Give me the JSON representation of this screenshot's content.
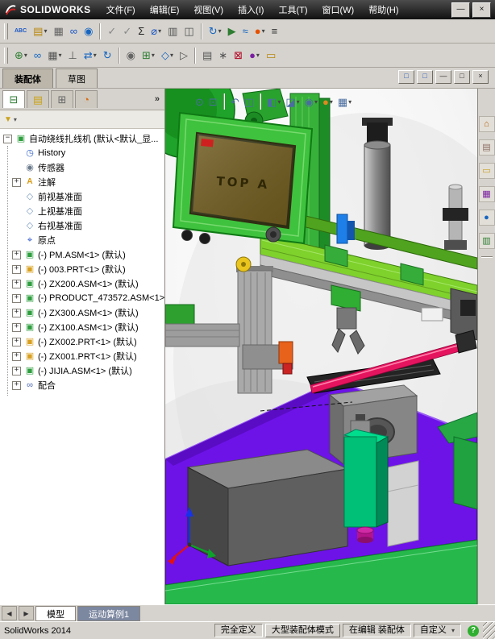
{
  "window": {
    "logo_text": "SOLIDWORKS"
  },
  "ui": {
    "minimize": "—",
    "close": "×",
    "caret": "▾",
    "chevron": "»",
    "funnel": "▼",
    "scroll_left": "◀",
    "scroll_right": "▶"
  },
  "menu": [
    {
      "name": "menu-file",
      "label": "文件(F)"
    },
    {
      "name": "menu-edit",
      "label": "编辑(E)"
    },
    {
      "name": "menu-view",
      "label": "视图(V)"
    },
    {
      "name": "menu-insert",
      "label": "插入(I)"
    },
    {
      "name": "menu-tools",
      "label": "工具(T)"
    },
    {
      "name": "menu-window",
      "label": "窗口(W)"
    },
    {
      "name": "menu-help",
      "label": "帮助(H)"
    }
  ],
  "toolbar_row1": [
    {
      "name": "spellcheck-icon",
      "glyph": "ABC",
      "color": "#1a56c4"
    },
    {
      "name": "design-binder-icon",
      "glyph": "▤",
      "color": "#b8860b",
      "caret": true
    },
    {
      "name": "design-table-icon",
      "glyph": "▦",
      "color": "#666666"
    },
    {
      "name": "hyperlink-icon",
      "glyph": "∞",
      "color": "#1a56c4"
    },
    {
      "name": "web-options-icon",
      "glyph": "◉",
      "color": "#1565c0"
    },
    {
      "sep": true
    },
    {
      "name": "select-filter-icon",
      "glyph": "✓",
      "color": "#888888"
    },
    {
      "name": "verification-icon",
      "glyph": "✓",
      "color": "#888888"
    },
    {
      "name": "equations-icon",
      "glyph": "Σ",
      "color": "#222222"
    },
    {
      "name": "measure-icon",
      "glyph": "⌀",
      "color": "#1a56c4",
      "caret": true
    },
    {
      "name": "mass-properties-icon",
      "glyph": "▥",
      "color": "#555555"
    },
    {
      "name": "section-properties-icon",
      "glyph": "◫",
      "color": "#555555"
    },
    {
      "sep": true
    },
    {
      "name": "motion-manager-icon",
      "glyph": "↻",
      "color": "#1565c0",
      "caret": true
    },
    {
      "name": "simulation-icon",
      "glyph": "▶",
      "color": "#2e7d32"
    },
    {
      "name": "flow-icon",
      "glyph": "≈",
      "color": "#1565c0"
    },
    {
      "name": "render-icon",
      "glyph": "●",
      "color": "#e65100",
      "caret": true
    },
    {
      "name": "options-icon",
      "glyph": "≡",
      "color": "#333333"
    }
  ],
  "toolbar_row2": [
    {
      "name": "insert-component-icon",
      "glyph": "⊕",
      "color": "#2e7d32",
      "caret": true
    },
    {
      "name": "mate-icon",
      "glyph": "∞",
      "color": "#1565c0"
    },
    {
      "name": "linear-pattern-icon",
      "glyph": "▦",
      "color": "#555555",
      "caret": true
    },
    {
      "name": "smart-fastener-icon",
      "glyph": "⊥",
      "color": "#555555"
    },
    {
      "name": "move-component-icon",
      "glyph": "⇄",
      "color": "#1565c0",
      "caret": true
    },
    {
      "name": "rotate-component-icon",
      "glyph": "↻",
      "color": "#1565c0"
    },
    {
      "sep": true
    },
    {
      "name": "show-hidden-icon",
      "glyph": "◉",
      "color": "#666666"
    },
    {
      "name": "assembly-features-icon",
      "glyph": "⊞",
      "color": "#2e7d32",
      "caret": true
    },
    {
      "name": "reference-geometry-icon",
      "glyph": "◇",
      "color": "#1565c0",
      "caret": true
    },
    {
      "name": "new-motion-study-icon",
      "glyph": "▷",
      "color": "#555555"
    },
    {
      "sep": true
    },
    {
      "name": "bom-icon",
      "glyph": "▤",
      "color": "#555555"
    },
    {
      "name": "exploded-view-icon",
      "glyph": "∗",
      "color": "#555555"
    },
    {
      "name": "interference-detection-icon",
      "glyph": "⊠",
      "color": "#b00020"
    },
    {
      "name": "appearances-toolbar-icon",
      "glyph": "●",
      "color": "#7b1fa2",
      "caret": true
    },
    {
      "name": "pack-and-go-icon",
      "glyph": "▭",
      "color": "#b8860b"
    }
  ],
  "panel_tabs": {
    "assembly": "装配体",
    "sketch": "草图"
  },
  "doc_controls": {
    "prev": "□",
    "next": "□",
    "minimize": "—",
    "restore": "□",
    "close": "×"
  },
  "manager_tabs": [
    {
      "name": "feature-manager-tab",
      "glyph": "⊟",
      "color": "#2e7d32",
      "active": true
    },
    {
      "name": "property-manager-tab",
      "glyph": "▤",
      "color": "#caa21a"
    },
    {
      "name": "configuration-manager-tab",
      "glyph": "⊞",
      "color": "#666666"
    },
    {
      "name": "display-manager-tab",
      "glyph": "◔",
      "color": "#d86a10"
    }
  ],
  "tree": {
    "root_label": "自动绕线扎线机",
    "root_suffix": "(默认<默认_显...",
    "root_glyph": "▣",
    "collapse_glyph": "−",
    "expand_glyph": "+",
    "items": [
      {
        "name": "tree-item-history",
        "icon": "history-icon",
        "glyph": "◷",
        "cls": "ic-blue",
        "label": "History"
      },
      {
        "name": "tree-item-sensors",
        "icon": "sensors-icon",
        "glyph": "◉",
        "cls": "ic-gray",
        "label": "传感器"
      },
      {
        "name": "tree-item-annotations",
        "icon": "annotations-icon",
        "glyph": "A",
        "cls": "ic-note",
        "label": "注解",
        "exp": true
      },
      {
        "name": "tree-item-front-plane",
        "icon": "plane-icon",
        "glyph": "◇",
        "cls": "ic-plane",
        "label": "前视基准面"
      },
      {
        "name": "tree-item-top-plane",
        "icon": "plane-icon",
        "glyph": "◇",
        "cls": "ic-plane",
        "label": "上视基准面"
      },
      {
        "name": "tree-item-right-plane",
        "icon": "plane-icon",
        "glyph": "◇",
        "cls": "ic-plane",
        "label": "右视基准面"
      },
      {
        "name": "tree-item-origin",
        "icon": "origin-icon",
        "glyph": "⌖",
        "cls": "ic-origin",
        "label": "原点"
      },
      {
        "name": "tree-item-pm-asm",
        "icon": "assembly-icon",
        "glyph": "▣",
        "cls": "ic-asm",
        "label": "(-) PM.ASM<1> (默认)",
        "exp": true
      },
      {
        "name": "tree-item-003-prt",
        "icon": "part-icon",
        "glyph": "▣",
        "cls": "ic-prt",
        "label": "(-) 003.PRT<1> (默认)",
        "exp": true
      },
      {
        "name": "tree-item-zx200-asm",
        "icon": "assembly-icon",
        "glyph": "▣",
        "cls": "ic-asm",
        "label": "(-) ZX200.ASM<1> (默认)",
        "exp": true
      },
      {
        "name": "tree-item-product-473572-asm",
        "icon": "assembly-icon",
        "glyph": "▣",
        "cls": "ic-asm",
        "label": "(-) PRODUCT_473572.ASM<1>",
        "exp": true
      },
      {
        "name": "tree-item-zx300-asm",
        "icon": "assembly-icon",
        "glyph": "▣",
        "cls": "ic-asm",
        "label": "(-) ZX300.ASM<1> (默认)",
        "exp": true
      },
      {
        "name": "tree-item-zx100-asm",
        "icon": "assembly-icon",
        "glyph": "▣",
        "cls": "ic-asm",
        "label": "(-) ZX100.ASM<1> (默认)",
        "exp": true
      },
      {
        "name": "tree-item-zx002-prt",
        "icon": "part-icon",
        "glyph": "▣",
        "cls": "ic-prt",
        "label": "(-) ZX002.PRT<1> (默认)",
        "exp": true
      },
      {
        "name": "tree-item-zx001-prt",
        "icon": "part-icon",
        "glyph": "▣",
        "cls": "ic-prt",
        "label": "(-) ZX001.PRT<1> (默认)",
        "exp": true
      },
      {
        "name": "tree-item-jijia-asm",
        "icon": "assembly-icon",
        "glyph": "▣",
        "cls": "ic-asm",
        "label": "(-) JIJIA.ASM<1> (默认)",
        "exp": true
      },
      {
        "name": "tree-item-mates",
        "icon": "mates-icon",
        "glyph": "∞",
        "cls": "ic-mate",
        "label": "配合",
        "exp": true
      }
    ]
  },
  "headsup": [
    {
      "name": "zoom-fit-icon",
      "glyph": "⊙"
    },
    {
      "name": "zoom-area-icon",
      "glyph": "⊡"
    },
    {
      "sep": true
    },
    {
      "name": "previous-view-icon",
      "glyph": "↶"
    },
    {
      "name": "section-view-icon",
      "glyph": "◫"
    },
    {
      "sep": true
    },
    {
      "name": "view-orientation-icon",
      "glyph": "◧",
      "caret": true
    },
    {
      "name": "display-style-icon",
      "glyph": "◪",
      "caret": true
    },
    {
      "name": "hide-show-icon",
      "glyph": "◉",
      "caret": true
    },
    {
      "name": "edit-appearance-icon",
      "glyph": "●",
      "color": "#e08820",
      "caret": true
    },
    {
      "name": "scene-icon",
      "glyph": "▦",
      "caret": true
    }
  ],
  "task_pane": [
    {
      "name": "resources-icon",
      "glyph": "⌂",
      "color": "#b35900"
    },
    {
      "name": "design-library-icon",
      "glyph": "▤",
      "color": "#8d6e63"
    },
    {
      "name": "file-explorer-icon",
      "glyph": "▭",
      "color": "#c9a227"
    },
    {
      "name": "view-palette-icon",
      "glyph": "▦",
      "color": "#7b1fa2"
    },
    {
      "name": "appearances-icon",
      "glyph": "●",
      "color": "#1565c0"
    },
    {
      "name": "custom-properties-icon",
      "glyph": "▥",
      "color": "#2e7d32"
    }
  ],
  "viewport": {
    "screen_label": "TOP A"
  },
  "bottom_tabs": {
    "model": "模型",
    "motion": "运动算例1"
  },
  "status": {
    "app": "SolidWorks 2014",
    "defined": "完全定义",
    "assembly_mode": "大型装配体模式",
    "editing": "在编辑 装配体",
    "custom": "自定义",
    "help": "?"
  }
}
